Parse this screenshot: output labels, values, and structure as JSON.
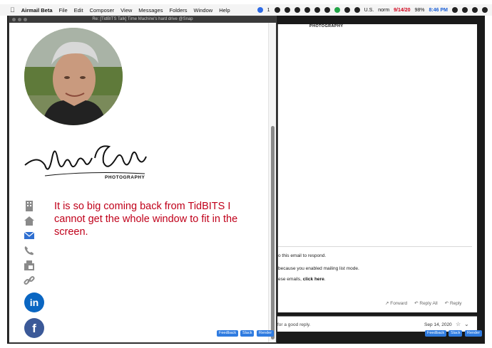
{
  "menubar": {
    "apple_icon": "apple-icon",
    "items": [
      "Airmail Beta",
      "File",
      "Edit",
      "Composer",
      "View",
      "Messages",
      "Folders",
      "Window",
      "Help"
    ],
    "status": {
      "badge_count": "1",
      "flag_label": "U.S.",
      "user": "norm",
      "date": "9/14/20",
      "battery": "98%",
      "time": "8:46 PM"
    },
    "colors": {
      "date": "#d0021b",
      "time": "#1a5fd6"
    }
  },
  "compose": {
    "window_title": "Re: [TidBITS Talk] Time Machine's hard drive @Snap",
    "signature_script": "Norm Gilbert",
    "signature_sub": "PHOTOGRAPHY",
    "message": "It is so big coming back from TidBITS I cannot get the whole window to fit in the screen.",
    "contact_icons": [
      "building-icon",
      "home-icon",
      "mail-icon",
      "phone-icon",
      "fax-icon",
      "link-icon"
    ],
    "social": {
      "linkedin": "in",
      "facebook": "f"
    },
    "buttons": {
      "feedback": "Feedback",
      "slack": "Slack",
      "render": "Render"
    },
    "message_color": "#c0001a"
  },
  "reader": {
    "header_sub": "PHOTOGRAPHY",
    "line1": "o this email to respond.",
    "line2": "because you enabled mailing list mode.",
    "line3_prefix": "ese emails, ",
    "line3_link": "click here",
    "line3_suffix": ".",
    "actions": {
      "forward": "Forward",
      "reply_all": "Reply All",
      "reply": "Reply"
    },
    "bottom": {
      "snippet": "for a good reply.",
      "date": "Sep 14, 2020"
    },
    "buttons": {
      "feedback": "Feedback",
      "slack": "Slack",
      "render": "Render"
    }
  }
}
